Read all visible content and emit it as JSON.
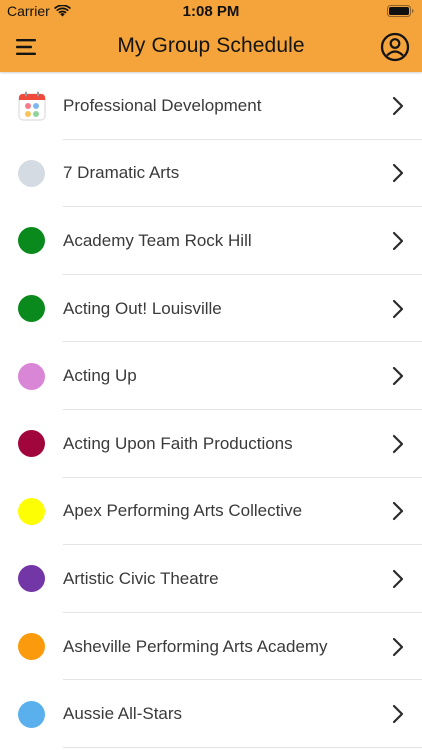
{
  "status_bar": {
    "carrier": "Carrier",
    "time": "1:08 PM"
  },
  "header": {
    "title": "My Group Schedule",
    "menu_icon": "hamburger-menu-icon",
    "profile_icon": "user-circle-icon",
    "background_color": "#f4a43a"
  },
  "list": {
    "items": [
      {
        "label": "Professional Development",
        "icon": "calendar-icon",
        "color": null
      },
      {
        "label": "7 Dramatic Arts",
        "icon": "color-dot",
        "color": "#d5dbe3"
      },
      {
        "label": "Academy Team Rock Hill",
        "icon": "color-dot",
        "color": "#0a8a1c"
      },
      {
        "label": "Acting Out! Louisville",
        "icon": "color-dot",
        "color": "#0a8a1c"
      },
      {
        "label": "Acting Up",
        "icon": "color-dot",
        "color": "#da86d6"
      },
      {
        "label": "Acting Upon Faith Productions",
        "icon": "color-dot",
        "color": "#a0063b"
      },
      {
        "label": "Apex Performing Arts Collective",
        "icon": "color-dot",
        "color": "#fdfd04"
      },
      {
        "label": "Artistic Civic Theatre",
        "icon": "color-dot",
        "color": "#7336a7"
      },
      {
        "label": "Asheville Performing Arts Academy",
        "icon": "color-dot",
        "color": "#fb9a0c"
      },
      {
        "label": "Aussie All-Stars",
        "icon": "color-dot",
        "color": "#5ab0ec"
      }
    ]
  }
}
